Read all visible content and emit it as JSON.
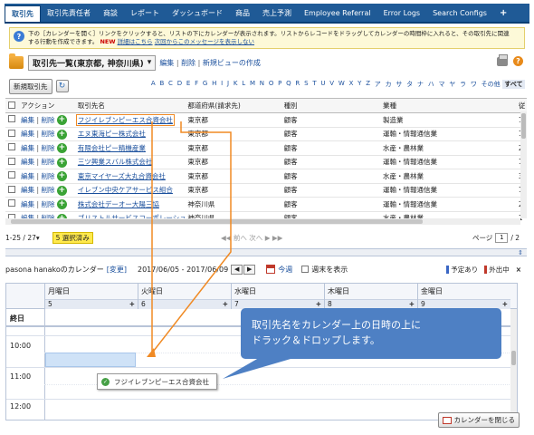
{
  "nav": {
    "tabs": [
      "取引先",
      "取引先責任者",
      "商談",
      "レポート",
      "ダッシュボード",
      "商品",
      "売上予測",
      "Employee Referral",
      "Error Logs",
      "Search Configs"
    ],
    "more": "+"
  },
  "info": {
    "line1": "下の［カレンダーを開く］リンクをクリックすると、リストの下にカレンダーが表示されます。リストからレコードをドラッグしてカレンダーの時間枠に入れると、その取引先に関連",
    "line2_a": "する行動を作成できます。",
    "badge": "NEW",
    "details": "詳細はこちら",
    "dismiss": "次回からこのメッセージを表示しない"
  },
  "header": {
    "view_label": "取引先一覧(東京都, 神奈川県)",
    "edit": "編集",
    "delete": "削除",
    "new_view": "新規ビューの作成"
  },
  "toolbar": {
    "new_button": "新規取引先",
    "alphabet": [
      "A",
      "B",
      "C",
      "D",
      "E",
      "F",
      "G",
      "H",
      "I",
      "J",
      "K",
      "L",
      "M",
      "N",
      "O",
      "P",
      "Q",
      "R",
      "S",
      "T",
      "U",
      "V",
      "W",
      "X",
      "Y",
      "Z",
      "ア",
      "カ",
      "サ",
      "タ",
      "ナ",
      "ハ",
      "マ",
      "ヤ",
      "ラ",
      "ワ",
      "その他",
      "すべて"
    ]
  },
  "table": {
    "headers": [
      "アクション",
      "取引先名",
      "都道府県(請求先)",
      "種別",
      "業種",
      "従"
    ],
    "rows": [
      {
        "action_edit": "編集",
        "action_delete": "削除",
        "name": "フジイレブンピーエス合資会社",
        "pref": "東京都",
        "type": "顧客",
        "industry": "製造業",
        "emp": "1"
      },
      {
        "action_edit": "編集",
        "action_delete": "削除",
        "name": "エヌ東海ピー株式会社",
        "pref": "東京都",
        "type": "顧客",
        "industry": "運輸・情報通信業",
        "emp": "1"
      },
      {
        "action_edit": "編集",
        "action_delete": "削除",
        "name": "有限会社ピー精機産業",
        "pref": "東京都",
        "type": "顧客",
        "industry": "水産・農林業",
        "emp": "2"
      },
      {
        "action_edit": "編集",
        "action_delete": "削除",
        "name": "三ツ興業スバル株式会社",
        "pref": "東京都",
        "type": "顧客",
        "industry": "運輸・情報通信業",
        "emp": "1"
      },
      {
        "action_edit": "編集",
        "action_delete": "削除",
        "name": "東京マイヤーズ大丸合資会社",
        "pref": "東京都",
        "type": "顧客",
        "industry": "水産・農林業",
        "emp": "3"
      },
      {
        "action_edit": "編集",
        "action_delete": "削除",
        "name": "イレブン中央ケアサービス組合",
        "pref": "東京都",
        "type": "顧客",
        "industry": "運輸・情報通信業",
        "emp": "1"
      },
      {
        "action_edit": "編集",
        "action_delete": "削除",
        "name": "株式会社デーオー大陽三協",
        "pref": "神奈川県",
        "type": "顧客",
        "industry": "運輸・情報通信業",
        "emp": "2"
      },
      {
        "action_edit": "編集",
        "action_delete": "削除",
        "name": "ブリストルサービスコーポレーショ…",
        "pref": "神奈川県",
        "type": "顧客",
        "industry": "水産・農林業",
        "emp": "1"
      }
    ]
  },
  "pager": {
    "count": "1-25 / 27",
    "selected": "5 選択済み",
    "nav": "◀◀ 前へ  次へ ▶ ▶▶",
    "page_label": "ページ",
    "page_value": "1",
    "page_total": "/ 2"
  },
  "calendar": {
    "owner": "pasona hanakoのカレンダー",
    "change": "[変更]",
    "range": "2017/06/05 - 2017/06/09",
    "today": "今週",
    "weekend": "週末を表示",
    "legend_busy": "予定あり",
    "legend_out": "外出中",
    "days": [
      {
        "name": "月曜日",
        "num": "5"
      },
      {
        "name": "火曜日",
        "num": "6"
      },
      {
        "name": "水曜日",
        "num": "7"
      },
      {
        "name": "木曜日",
        "num": "8"
      },
      {
        "name": "金曜日",
        "num": "9"
      }
    ],
    "allday": "終日",
    "times": [
      "10:00",
      "11:00",
      "12:00"
    ],
    "drag_item": "フジイレブンピーエス合資会社",
    "close": "カレンダーを閉じる"
  },
  "callout": {
    "line1": "取引先名をカレンダー上の日時の上に",
    "line2": "ドラック＆ドロップします。"
  },
  "colors": {
    "nav": "#1f5a96",
    "callout": "#4e80c4",
    "arrow": "#f08a24"
  }
}
